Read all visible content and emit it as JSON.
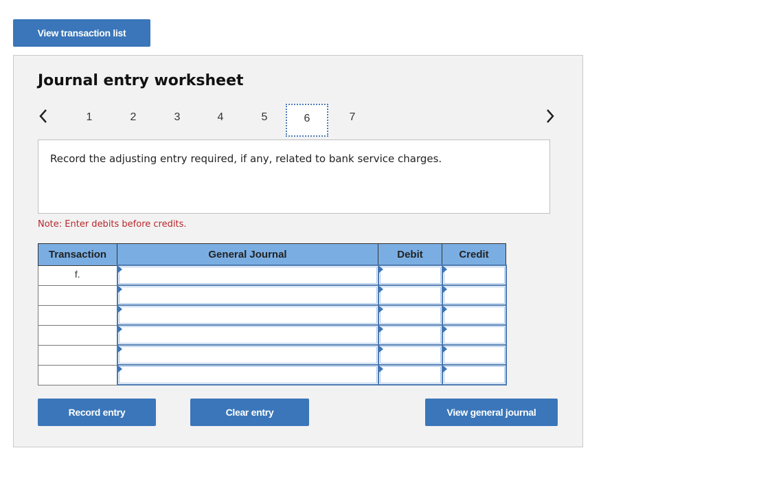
{
  "top_button": {
    "label": "View transaction list"
  },
  "worksheet": {
    "title": "Journal entry worksheet",
    "pager": {
      "prev_icon": "chevron-left-icon",
      "next_icon": "chevron-right-icon",
      "pages": [
        "1",
        "2",
        "3",
        "4",
        "5",
        "6",
        "7"
      ],
      "active_page": "6"
    },
    "prompt": "Record the adjusting entry required, if any, related to bank service charges.",
    "note": "Note: Enter debits before credits.",
    "table": {
      "columns": [
        "Transaction",
        "General Journal",
        "Debit",
        "Credit"
      ],
      "rows": [
        {
          "transaction": "f.",
          "account": "",
          "debit": "",
          "credit": ""
        },
        {
          "transaction": "",
          "account": "",
          "debit": "",
          "credit": ""
        },
        {
          "transaction": "",
          "account": "",
          "debit": "",
          "credit": ""
        },
        {
          "transaction": "",
          "account": "",
          "debit": "",
          "credit": ""
        },
        {
          "transaction": "",
          "account": "",
          "debit": "",
          "credit": ""
        },
        {
          "transaction": "",
          "account": "",
          "debit": "",
          "credit": ""
        }
      ]
    },
    "buttons": {
      "record": "Record entry",
      "clear": "Clear entry",
      "view_journal": "View general journal"
    }
  },
  "colors": {
    "button_blue": "#3a76b9",
    "header_blue": "#7aaee3",
    "note_red": "#b8262b",
    "panel_bg": "#f2f2f2"
  }
}
